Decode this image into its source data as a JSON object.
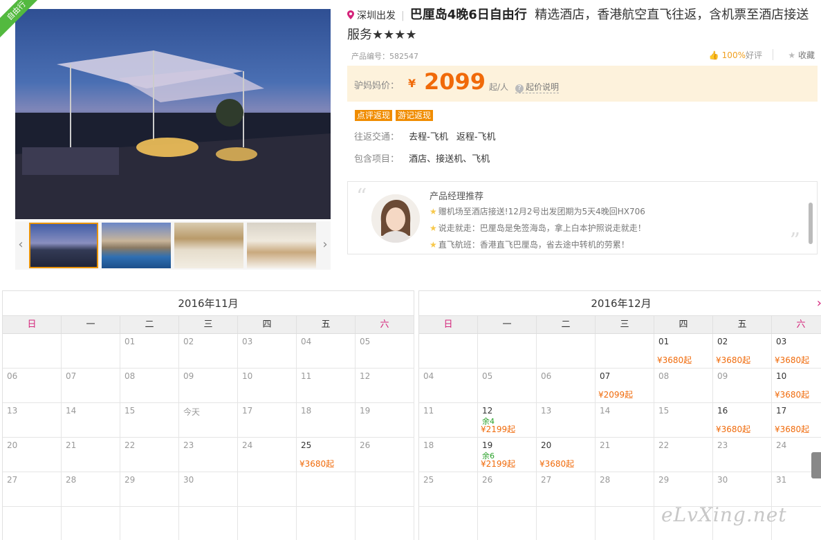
{
  "ribbon": "自由行",
  "product": {
    "depart": "深圳出发",
    "title": "巴厘岛4晚6日自由行",
    "desc": "精选酒店，香港航空直飞往返，含机票至酒店接送服务★★★★",
    "product_no_label": "产品编号：",
    "product_no": "582547",
    "rating_pct": "100%",
    "rating_label": "好评",
    "fav_label": "收藏"
  },
  "price": {
    "label": "驴妈妈价：",
    "currency": "¥",
    "amount": "2099",
    "unit": "起/人",
    "help": "起价说明"
  },
  "tags": [
    "点评返现",
    "游记返现"
  ],
  "transport": {
    "label": "往返交通：",
    "go": "去程-飞机",
    "back": "返程-飞机"
  },
  "includes": {
    "label": "包含项目：",
    "value": "酒店、接送机、飞机"
  },
  "recommend": {
    "title": "产品经理推荐",
    "items": [
      "赠机场至酒店接送!12月2号出发团期为5天4晚回HX706",
      "说走就走：巴厘岛是免签海岛，拿上白本护照说走就走！",
      "直飞航班：香港直飞巴厘岛，省去途中转机的劳累！"
    ]
  },
  "weekdays": [
    "日",
    "一",
    "二",
    "三",
    "四",
    "五",
    "六"
  ],
  "calendars": [
    {
      "title": "2016年11月",
      "weeks": [
        [
          {
            "d": ""
          },
          {
            "d": ""
          },
          {
            "d": "01"
          },
          {
            "d": "02"
          },
          {
            "d": "03"
          },
          {
            "d": "04"
          },
          {
            "d": "05"
          }
        ],
        [
          {
            "d": "06"
          },
          {
            "d": "07"
          },
          {
            "d": "08"
          },
          {
            "d": "09"
          },
          {
            "d": "10"
          },
          {
            "d": "11"
          },
          {
            "d": "12"
          }
        ],
        [
          {
            "d": "13"
          },
          {
            "d": "14"
          },
          {
            "d": "15"
          },
          {
            "d": "今天"
          },
          {
            "d": "17"
          },
          {
            "d": "18"
          },
          {
            "d": "19"
          }
        ],
        [
          {
            "d": "20"
          },
          {
            "d": "21"
          },
          {
            "d": "22"
          },
          {
            "d": "23"
          },
          {
            "d": "24"
          },
          {
            "d": "25",
            "p": "¥3680起"
          },
          {
            "d": "26"
          }
        ],
        [
          {
            "d": "27"
          },
          {
            "d": "28"
          },
          {
            "d": "29"
          },
          {
            "d": "30"
          },
          {
            "d": ""
          },
          {
            "d": ""
          },
          {
            "d": ""
          }
        ],
        [
          {
            "d": ""
          },
          {
            "d": ""
          },
          {
            "d": ""
          },
          {
            "d": ""
          },
          {
            "d": ""
          },
          {
            "d": ""
          },
          {
            "d": ""
          }
        ]
      ]
    },
    {
      "title": "2016年12月",
      "weeks": [
        [
          {
            "d": ""
          },
          {
            "d": ""
          },
          {
            "d": ""
          },
          {
            "d": ""
          },
          {
            "d": "01",
            "p": "¥3680起"
          },
          {
            "d": "02",
            "p": "¥3680起"
          },
          {
            "d": "03",
            "p": "¥3680起"
          }
        ],
        [
          {
            "d": "04"
          },
          {
            "d": "05"
          },
          {
            "d": "06"
          },
          {
            "d": "07",
            "p": "¥2099起"
          },
          {
            "d": "08"
          },
          {
            "d": "09"
          },
          {
            "d": "10",
            "p": "¥3680起"
          }
        ],
        [
          {
            "d": "11"
          },
          {
            "d": "12",
            "left": "余4",
            "p": "¥2199起"
          },
          {
            "d": "13"
          },
          {
            "d": "14"
          },
          {
            "d": "15"
          },
          {
            "d": "16",
            "p": "¥3680起"
          },
          {
            "d": "17",
            "p": "¥3680起"
          }
        ],
        [
          {
            "d": "18"
          },
          {
            "d": "19",
            "left": "余6",
            "p": "¥2199起"
          },
          {
            "d": "20",
            "p": "¥3680起"
          },
          {
            "d": "21"
          },
          {
            "d": "22"
          },
          {
            "d": "23"
          },
          {
            "d": "24"
          }
        ],
        [
          {
            "d": "25"
          },
          {
            "d": "26"
          },
          {
            "d": "27"
          },
          {
            "d": "28"
          },
          {
            "d": "29"
          },
          {
            "d": "30"
          },
          {
            "d": "31"
          }
        ],
        [
          {
            "d": ""
          },
          {
            "d": ""
          },
          {
            "d": ""
          },
          {
            "d": ""
          },
          {
            "d": ""
          },
          {
            "d": ""
          },
          {
            "d": ""
          }
        ]
      ]
    }
  ],
  "watermark": "eLvXing.net",
  "colors": {
    "accent": "#f06a0a",
    "ribbon": "#53b93f",
    "price_bg": "#fdf2dc",
    "weekend": "#d4237a",
    "stock": "#28a028"
  }
}
